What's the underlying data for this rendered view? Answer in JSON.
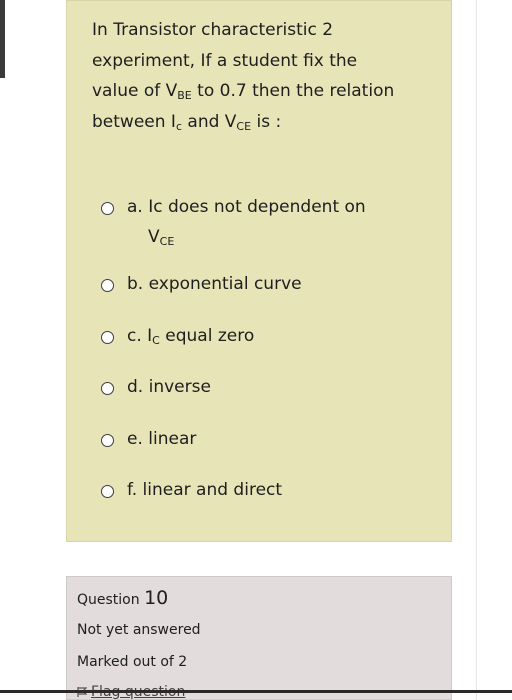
{
  "question": {
    "line1": "In Transistor characteristic 2",
    "line2": "experiment, If a student fix the",
    "line3_a": "value of V",
    "line3_sub": "BE",
    "line3_b": " to 0.7 then the relation",
    "line4_a": "between I",
    "line4_sub1": "c",
    "line4_b": " and V",
    "line4_sub2": "CE",
    "line4_c": " is :"
  },
  "options": [
    {
      "text": "a. Ic does not dependent on",
      "cont": "V",
      "cont_sub": "CE"
    },
    {
      "text": "b. exponential curve"
    },
    {
      "text_a": "c. I",
      "sub": "C",
      "text_b": " equal zero"
    },
    {
      "text": "d. inverse"
    },
    {
      "text": "e. linear"
    },
    {
      "text": "f. linear and direct"
    }
  ],
  "info": {
    "question_label": "Question",
    "question_number": "10",
    "status": "Not yet answered",
    "marks": "Marked out of 2",
    "flag": "Flag question"
  }
}
